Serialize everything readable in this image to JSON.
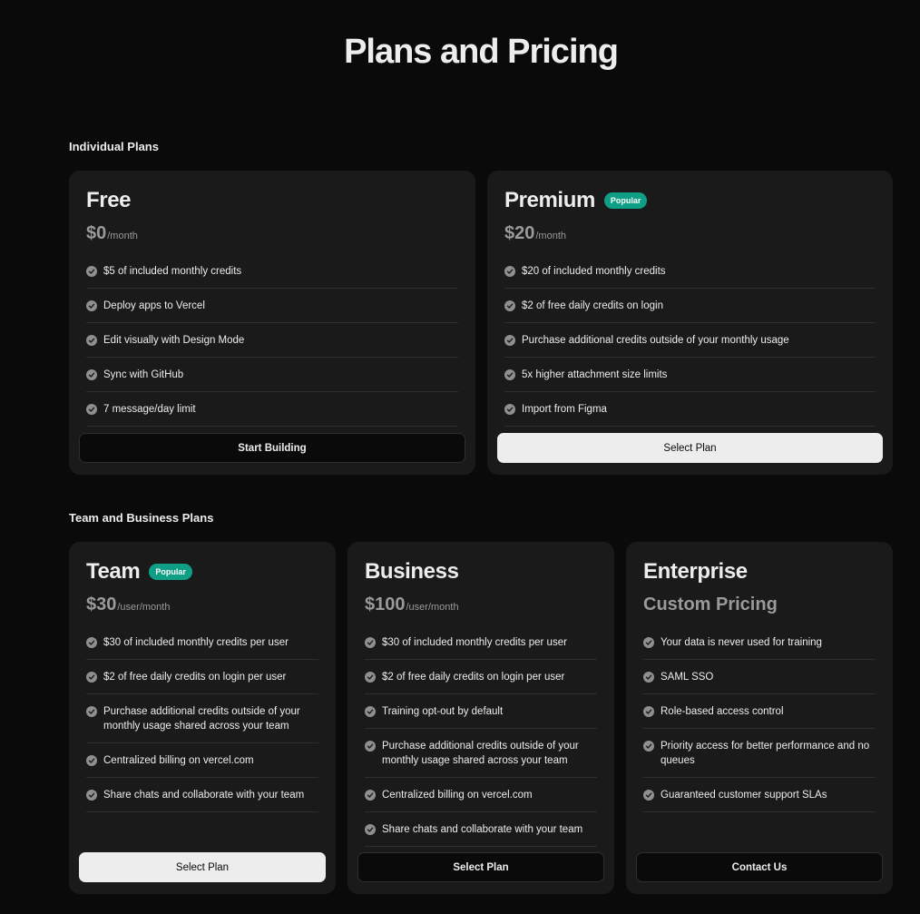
{
  "page": {
    "title": "Plans and Pricing"
  },
  "sections": {
    "individual": "Individual Plans",
    "team": "Team and Business Plans"
  },
  "colors": {
    "background": "#0a0a0a",
    "card": "#1a1a1a",
    "badge": "#0f9f86"
  },
  "plans": {
    "free": {
      "name": "Free",
      "price": "$0",
      "unit": "/month",
      "features": [
        "$5 of included monthly credits",
        "Deploy apps to Vercel",
        "Edit visually with Design Mode",
        "Sync with GitHub",
        "7 message/day limit"
      ],
      "cta": "Start Building"
    },
    "premium": {
      "name": "Premium",
      "badge": "Popular",
      "price": "$20",
      "unit": "/month",
      "features": [
        "$20 of included monthly credits",
        "$2 of free daily credits on login",
        "Purchase additional credits outside of your monthly usage",
        "5x higher attachment size limits",
        "Import from Figma"
      ],
      "cta": "Select Plan"
    },
    "team": {
      "name": "Team",
      "badge": "Popular",
      "price": "$30",
      "unit": "/user/month",
      "features": [
        "$30 of included monthly credits per user",
        "$2 of free daily credits on login per user",
        "Purchase additional credits outside of your monthly usage shared across your team",
        "Centralized billing on vercel.com",
        "Share chats and collaborate with your team"
      ],
      "cta": "Select Plan"
    },
    "business": {
      "name": "Business",
      "price": "$100",
      "unit": "/user/month",
      "features": [
        "$30 of included monthly credits per user",
        "$2 of free daily credits on login per user",
        "Training opt-out by default",
        "Purchase additional credits outside of your monthly usage shared across your team",
        "Centralized billing on vercel.com",
        "Share chats and collaborate with your team"
      ],
      "cta": "Select Plan"
    },
    "enterprise": {
      "name": "Enterprise",
      "price": "Custom Pricing",
      "unit": "",
      "features": [
        "Your data is never used for training",
        "SAML SSO",
        "Role-based access control",
        "Priority access for better performance and no queues",
        "Guaranteed customer support SLAs"
      ],
      "cta": "Contact Us"
    }
  }
}
